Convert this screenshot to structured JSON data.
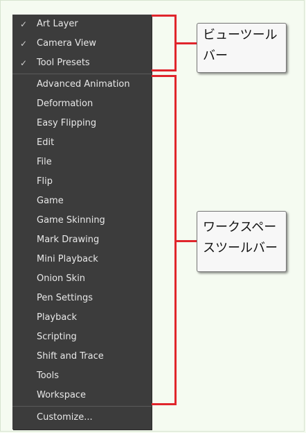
{
  "menu": {
    "checked_items": [
      {
        "label": "Art Layer",
        "checked": true
      },
      {
        "label": "Camera View",
        "checked": true
      },
      {
        "label": "Tool Presets",
        "checked": true
      }
    ],
    "workspace_items": [
      {
        "label": "Advanced Animation"
      },
      {
        "label": "Deformation"
      },
      {
        "label": "Easy Flipping"
      },
      {
        "label": "Edit"
      },
      {
        "label": "File"
      },
      {
        "label": "Flip"
      },
      {
        "label": "Game"
      },
      {
        "label": "Game Skinning"
      },
      {
        "label": "Mark Drawing"
      },
      {
        "label": "Mini Playback"
      },
      {
        "label": "Onion Skin"
      },
      {
        "label": "Pen Settings"
      },
      {
        "label": "Playback"
      },
      {
        "label": "Scripting"
      },
      {
        "label": "Shift and Trace"
      },
      {
        "label": "Tools"
      },
      {
        "label": "Workspace"
      }
    ],
    "customize_label": "Customize...",
    "check_glyph": "✓"
  },
  "callouts": {
    "view_toolbars": "ビューツール\nバー",
    "workspace_toolbars": "ワークスペー\nスツールバー"
  },
  "colors": {
    "menu_bg": "#3c3c3c",
    "bracket": "#e0252c",
    "page_bg": "#f5fbf1"
  }
}
